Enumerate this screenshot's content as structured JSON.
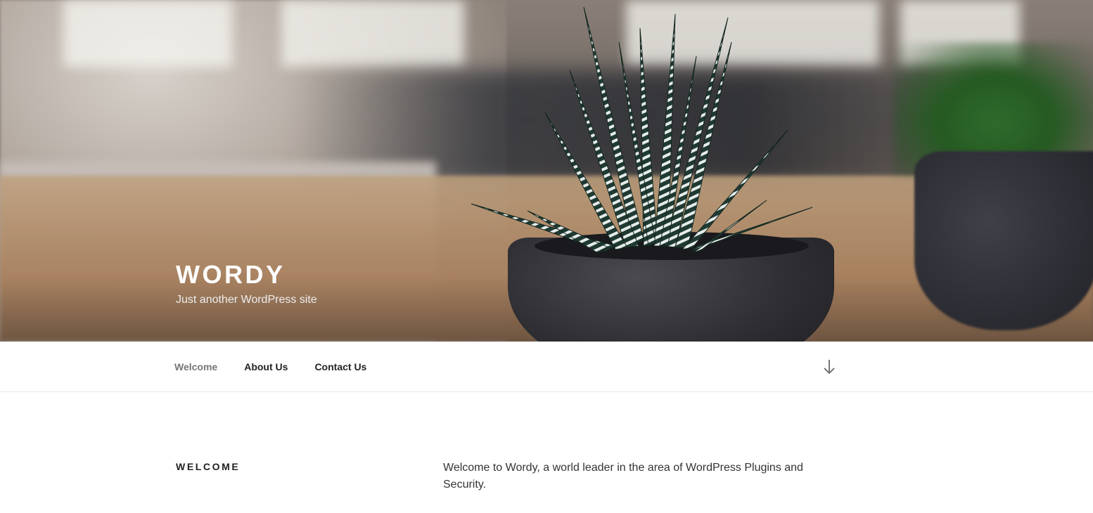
{
  "site": {
    "title": "WORDY",
    "tagline": "Just another WordPress site"
  },
  "nav": {
    "items": [
      {
        "label": "Welcome",
        "current": true
      },
      {
        "label": "About Us",
        "current": false
      },
      {
        "label": "Contact Us",
        "current": false
      }
    ],
    "scroll_icon": "arrow-down-icon"
  },
  "page": {
    "title": "WELCOME",
    "body": "Welcome to Wordy, a world leader in the area of WordPress Plugins and Security."
  },
  "colors": {
    "text_dark": "#222222",
    "text_muted": "#767676",
    "border": "#e6e6e6"
  }
}
